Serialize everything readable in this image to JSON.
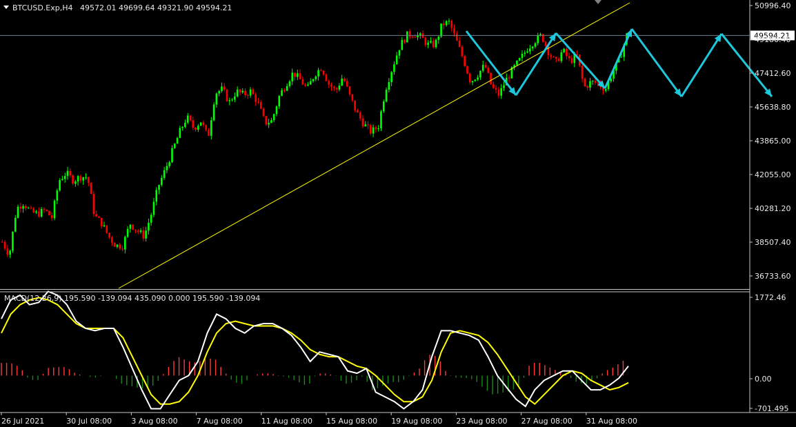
{
  "header": {
    "symbol": "BTCUSD.Exp,H4",
    "ohlc": "49572.01 49699.64 49321.90 49594.21"
  },
  "main_axis": {
    "ticks": [
      "50996.40",
      "49186.40",
      "47412.60",
      "45638.80",
      "43865.00",
      "42055.00",
      "40281.20",
      "38507.40",
      "36733.60"
    ],
    "current_price": "49594.21"
  },
  "macd": {
    "label": "MACD(12,26,9) 195.590 -139.094 435.090 0.000 195.590 -139.094",
    "ticks": [
      "1772.46",
      "0.00",
      "-701.495"
    ]
  },
  "time_axis": {
    "labels": [
      "26 Jul 2021",
      "30 Jul 08:00",
      "3 Aug 08:00",
      "7 Aug 08:00",
      "11 Aug 08:00",
      "15 Aug 08:00",
      "19 Aug 08:00",
      "23 Aug 08:00",
      "27 Aug 08:00",
      "31 Aug 08:00"
    ]
  },
  "colors": {
    "bull": "#00ff00",
    "bear": "#ff0000",
    "trendline": "#ffff00",
    "arrows": "#1ec8dc",
    "macd_line": "#ffffff",
    "signal_line": "#ffff00",
    "hist_pos": "#ff3a3a",
    "hist_neg": "#1a8a1a",
    "axis": "#c8c8c8",
    "bid_line": "#708090"
  },
  "chart_data": [
    {
      "type": "candlestick",
      "ylim": [
        36000,
        51500
      ],
      "price_path": [
        38500,
        37800,
        40300,
        40600,
        40100,
        40000,
        40200,
        39800,
        41800,
        42200,
        41800,
        42000,
        42000,
        39900,
        39500,
        38800,
        38300,
        38300,
        39500,
        39100,
        38800,
        40000,
        41500,
        42400,
        43400,
        44400,
        45200,
        44600,
        45000,
        44100,
        46500,
        46700,
        46000,
        46600,
        46400,
        46600,
        46000,
        44900,
        45000,
        46300,
        47000,
        47600,
        47200,
        46700,
        47500,
        47900,
        47000,
        46600,
        47400,
        46300,
        45400,
        44800,
        44400,
        44700,
        46700,
        47900,
        49000,
        49600,
        49700,
        49500,
        49100,
        49100,
        50200,
        50300,
        49300,
        48300,
        47100,
        47500,
        48000,
        46800,
        46400,
        47200,
        47800,
        48300,
        48900,
        49300,
        49600,
        48700,
        48100,
        48800,
        48200,
        48500,
        46800,
        47100,
        47000,
        46700,
        47600,
        48300,
        49600
      ],
      "current": 49594.21
    },
    {
      "type": "line",
      "name": "MACD(12,26,9)",
      "ylim": [
        -780,
        1772.46
      ],
      "macd": [
        1200,
        1600,
        1700,
        1500,
        1550,
        1780,
        1700,
        1500,
        1150,
        1000,
        950,
        1000,
        1000,
        600,
        150,
        -300,
        -700,
        -700,
        -400,
        -100,
        0,
        300,
        900,
        1300,
        1200,
        1000,
        900,
        1050,
        1100,
        1100,
        1000,
        850,
        600,
        300,
        500,
        450,
        400,
        100,
        50,
        150,
        -350,
        -450,
        -550,
        -700,
        -550,
        -300,
        400,
        950,
        950,
        900,
        850,
        750,
        400,
        0,
        -250,
        -500,
        -650,
        -300,
        -100,
        0,
        100,
        100,
        -100,
        -300,
        -300,
        -200,
        -50,
        200
      ],
      "signal": [
        900,
        1300,
        1500,
        1600,
        1650,
        1600,
        1500,
        1300,
        1100,
        1000,
        1000,
        1000,
        1000,
        800,
        400,
        0,
        -400,
        -600,
        -600,
        -550,
        -350,
        0,
        500,
        900,
        1100,
        1150,
        1100,
        1050,
        1050,
        1050,
        1000,
        900,
        750,
        550,
        450,
        400,
        400,
        300,
        200,
        150,
        0,
        -200,
        -400,
        -550,
        -550,
        -450,
        -100,
        500,
        900,
        950,
        900,
        850,
        700,
        450,
        150,
        -150,
        -450,
        -600,
        -400,
        -200,
        0,
        100,
        50,
        -100,
        -200,
        -300,
        -250,
        -150
      ],
      "hist_length": 120
    }
  ]
}
